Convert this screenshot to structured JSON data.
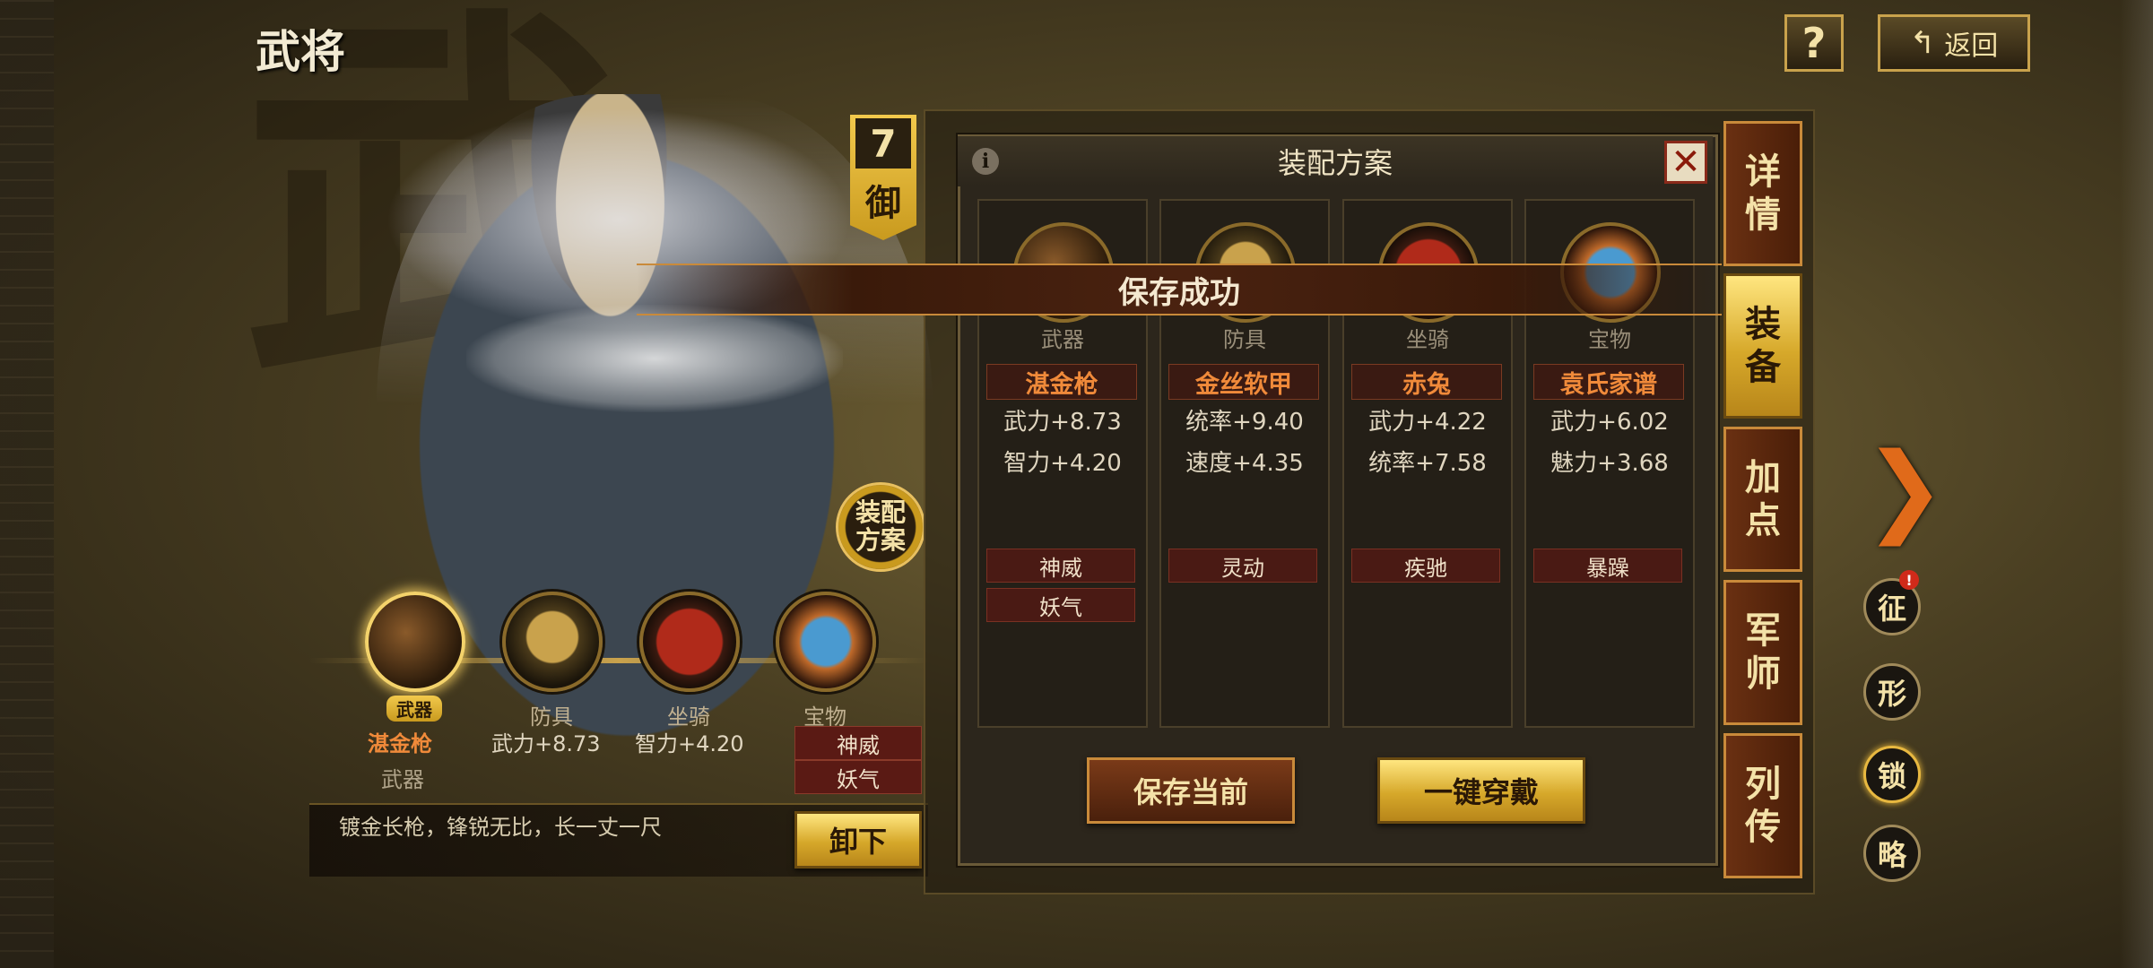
{
  "header": {
    "title": "武将",
    "help_label": "?",
    "back_label": "返回"
  },
  "background_glyph": "武",
  "hero": {
    "level": "7",
    "class_char": "御",
    "loadout_seal": "装配方案"
  },
  "equip_strip": {
    "slots": [
      {
        "label": "武器",
        "active": true
      },
      {
        "label": "防具"
      },
      {
        "label": "坐骑"
      },
      {
        "label": "宝物"
      }
    ],
    "selected_name": "湛金枪",
    "selected_type": "武器",
    "stat_1": "武力+8.73",
    "stat_2": "智力+4.20",
    "skills": [
      "神威",
      "妖气"
    ],
    "description": "镀金长枪，锋锐无比，长一丈一尺",
    "unequip_label": "卸下"
  },
  "dialog": {
    "title": "装配方案",
    "banner": "保存成功",
    "columns": [
      {
        "slot": "武器",
        "name": "湛金枪",
        "stats": [
          "武力+8.73",
          "智力+4.20"
        ],
        "skills": [
          "神威",
          "妖气"
        ]
      },
      {
        "slot": "防具",
        "name": "金丝软甲",
        "stats": [
          "统率+9.40",
          "速度+4.35"
        ],
        "skills": [
          "灵动"
        ]
      },
      {
        "slot": "坐骑",
        "name": "赤兔",
        "stats": [
          "武力+4.22",
          "统率+7.58"
        ],
        "skills": [
          "疾驰"
        ]
      },
      {
        "slot": "宝物",
        "name": "袁氏家谱",
        "stats": [
          "武力+6.02",
          "魅力+3.68"
        ],
        "skills": [
          "暴躁"
        ]
      }
    ],
    "save_current_label": "保存当前",
    "equip_all_label": "一键穿戴"
  },
  "side_tabs": [
    {
      "label": "详情"
    },
    {
      "label": "装备",
      "active": true
    },
    {
      "label": "加点"
    },
    {
      "label": "军师"
    },
    {
      "label": "列传"
    }
  ],
  "side_round_buttons": [
    "征",
    "形",
    "锁",
    "略"
  ],
  "alert_badge": "!",
  "colors": {
    "gold": "#d6a82a",
    "accent_orange": "#f08a3a",
    "dark_red": "#4a1a14"
  }
}
